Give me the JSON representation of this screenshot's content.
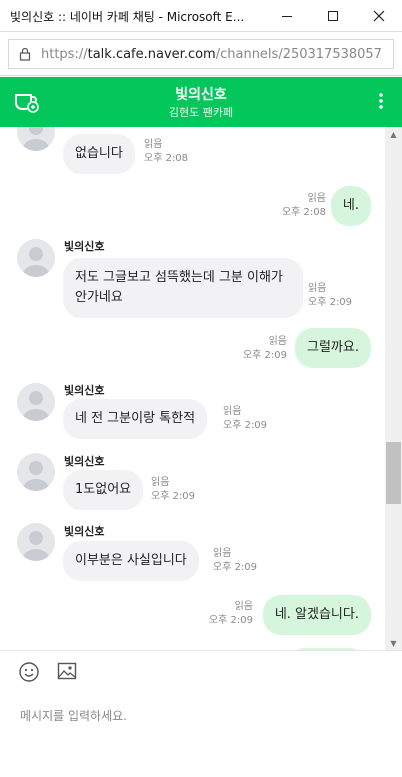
{
  "window": {
    "title": "빛의신호 :: 네이버 카페 채팅 - Microsoft E..."
  },
  "browser": {
    "url_scheme": "https://",
    "url_host": "talk.cafe.naver.com",
    "url_path": "/channels/250317538057"
  },
  "chat_header": {
    "name": "빛의신호",
    "subtitle": "김현도 팬카페"
  },
  "messages": [
    {
      "side": "in",
      "sender": "",
      "text": "없습니다",
      "read": "읽음",
      "time": "오후 2:08"
    },
    {
      "side": "out",
      "text": "네.",
      "read": "읽음",
      "time": "오후 2:08"
    },
    {
      "side": "in",
      "sender": "빛의신호",
      "text": "저도 그글보고 섬뜩했는데 그분 이해가 안가네요",
      "read": "읽음",
      "time": "오후 2:09"
    },
    {
      "side": "out",
      "text": "그럴까요.",
      "read": "읽음",
      "time": "오후 2:09"
    },
    {
      "side": "in",
      "sender": "빛의신호",
      "text": "네 전 그분이랑 톡한적",
      "read": "읽음",
      "time": "오후 2:09"
    },
    {
      "side": "in",
      "sender": "빛의신호",
      "text": "1도없어요",
      "read": "읽음",
      "time": "오후 2:09"
    },
    {
      "side": "in",
      "sender": "빛의신호",
      "text": "이부분은 사실입니다",
      "read": "읽음",
      "time": "오후 2:09"
    },
    {
      "side": "out",
      "text": "네. 알겠습니다.",
      "read": "읽음",
      "time": "오후 2:09"
    }
  ],
  "composer": {
    "placeholder": "메시지를 입력하세요."
  },
  "colors": {
    "brand_green": "#03c75a",
    "outgoing_bubble": "#d6f5dd",
    "incoming_bubble": "#f2f2f4"
  },
  "icons": [
    "lock-icon",
    "cafe-icon",
    "more-vertical-icon",
    "emoji-icon",
    "image-icon",
    "minimize-icon",
    "maximize-icon",
    "close-icon"
  ]
}
